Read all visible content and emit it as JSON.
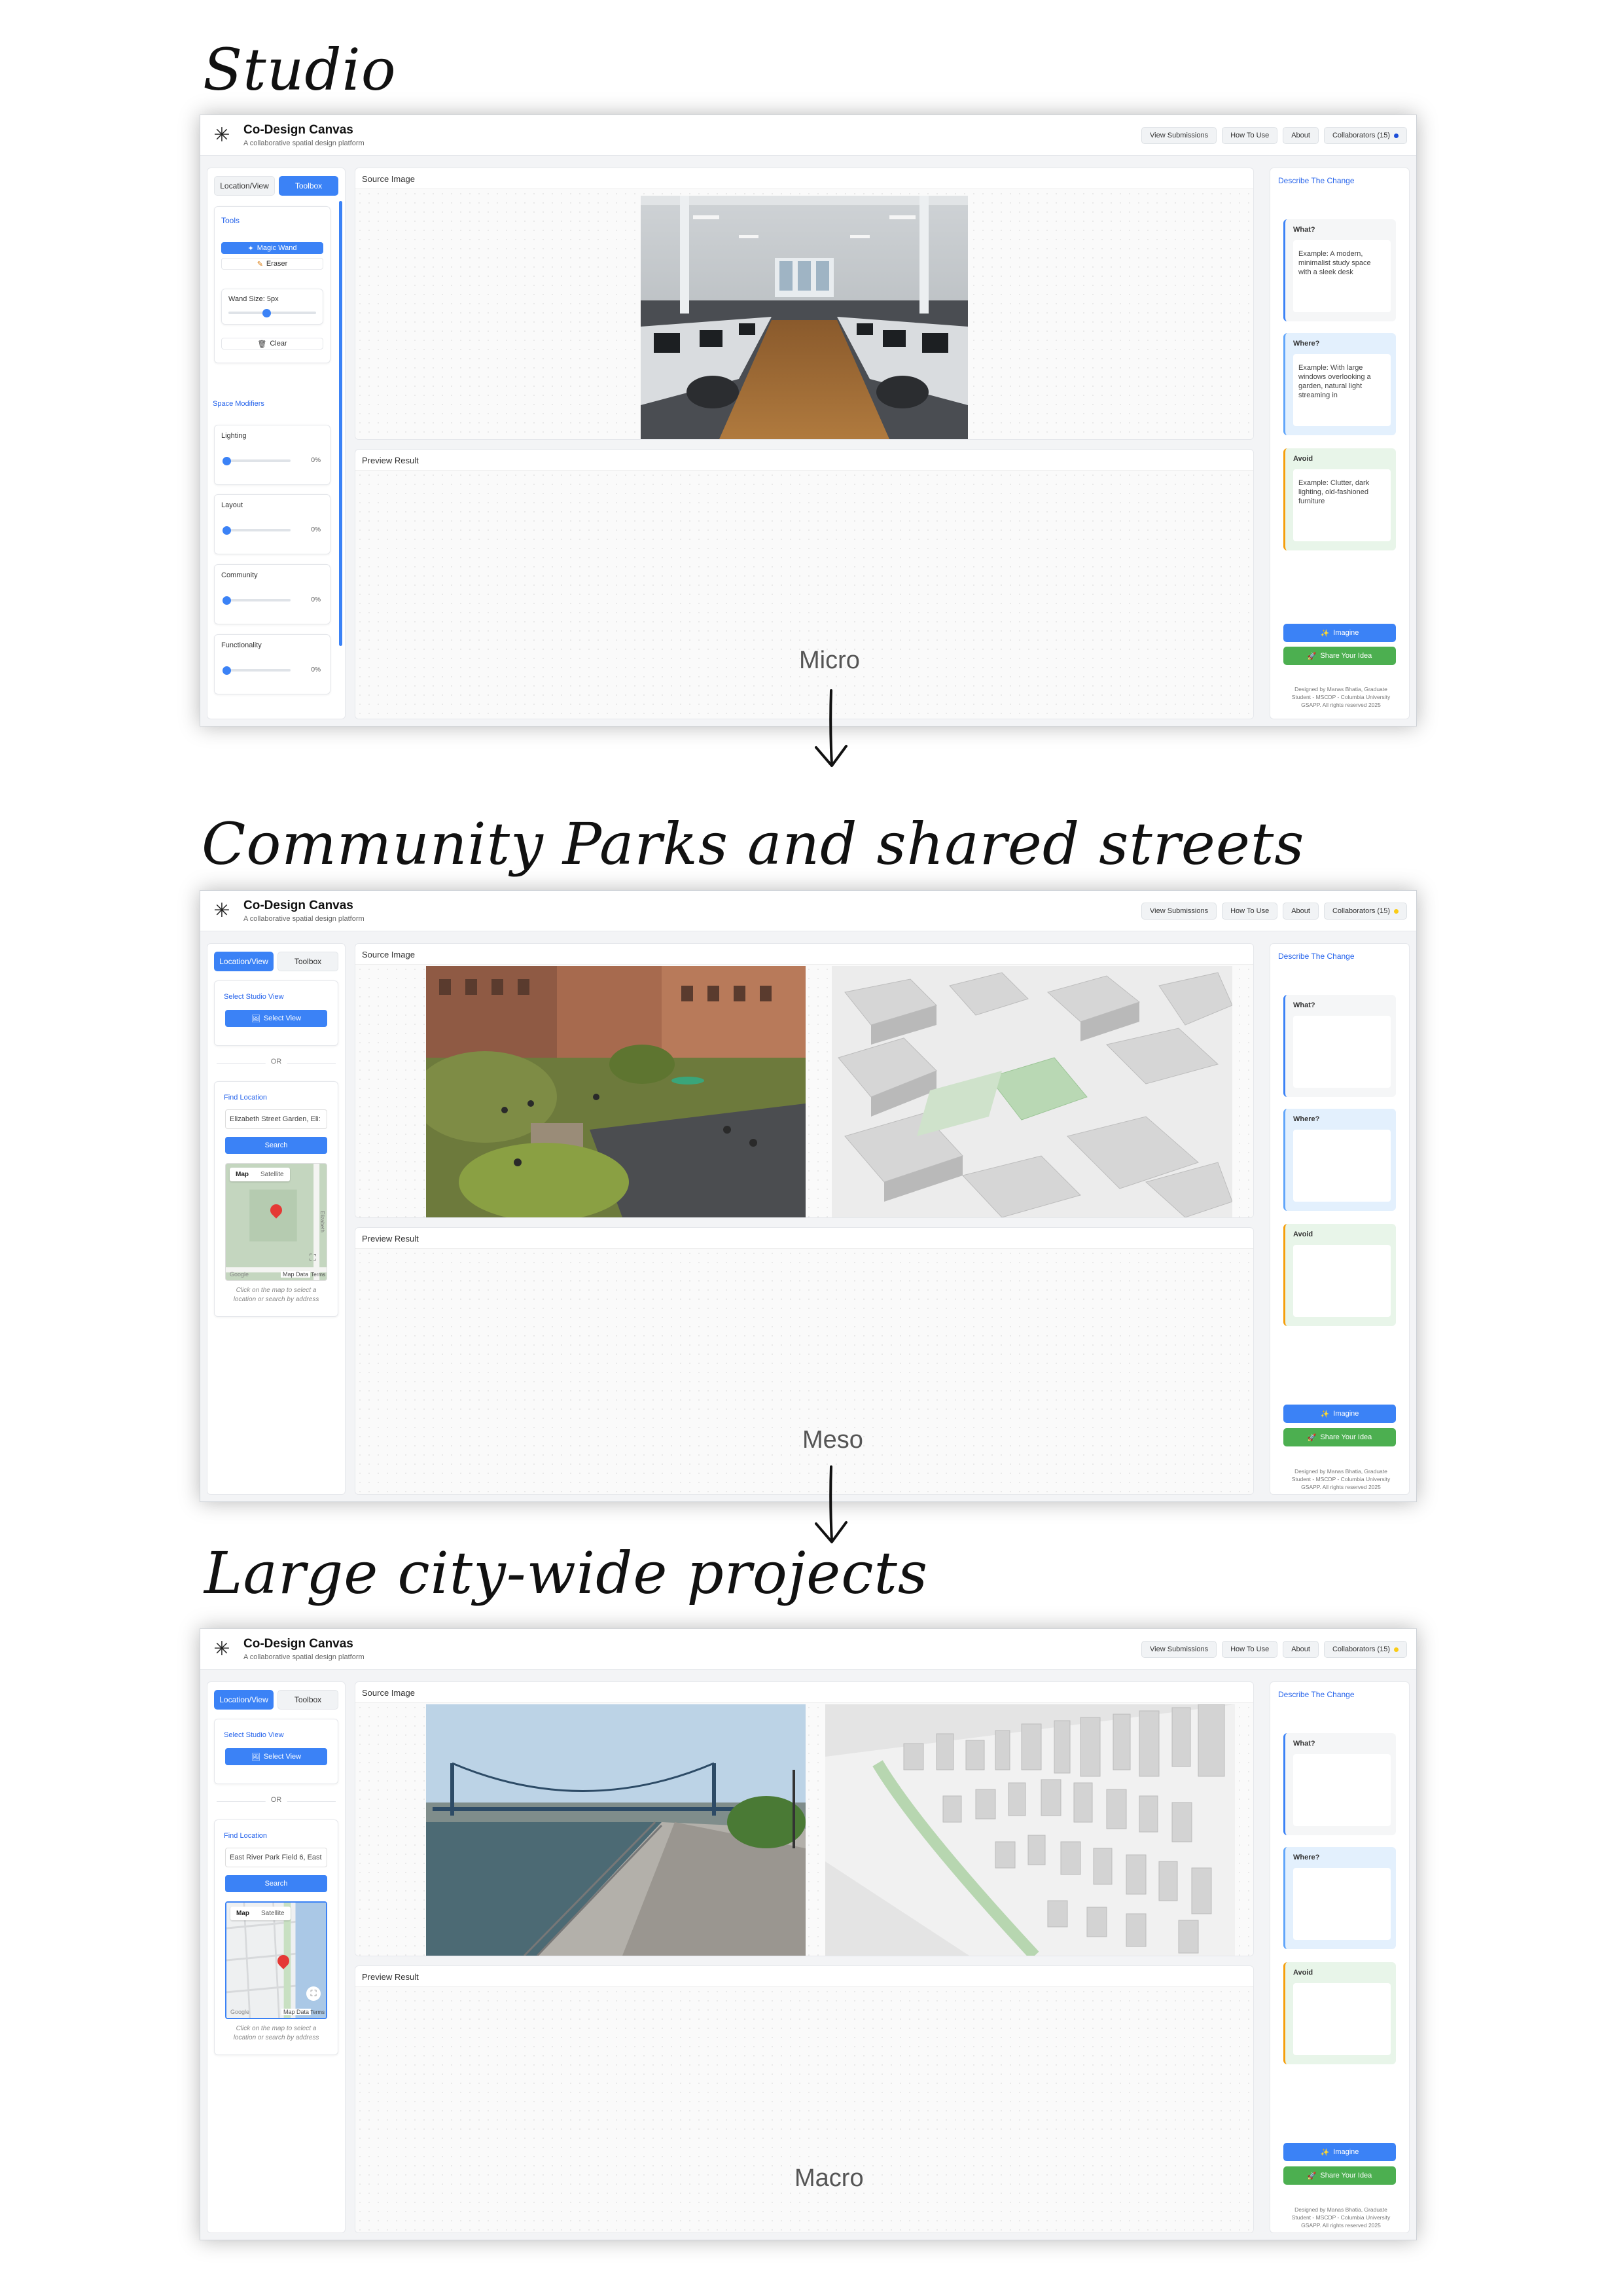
{
  "headings": {
    "studio": "Studio",
    "community": "Community Parks and shared streets",
    "large": "Large city-wide projects"
  },
  "scale_labels": {
    "micro": "Micro",
    "meso": "Meso",
    "macro": "Macro"
  },
  "app": {
    "title": "Co-Design Canvas",
    "subtitle": "A collaborative spatial design platform",
    "nav": {
      "view_submissions": "View Submissions",
      "how_to_use": "How To Use",
      "about": "About",
      "collaborators": "Collaborators (15)"
    },
    "status_colors": {
      "studio": "#1d4ed8",
      "meso": "#facc15",
      "macro": "#facc15"
    }
  },
  "tabs": {
    "location_view": "Location/View",
    "toolbox": "Toolbox"
  },
  "tools": {
    "section": "Tools",
    "magic_wand": "Magic Wand",
    "eraser": "Eraser",
    "wand_size": "Wand Size: 5px",
    "clear": "Clear"
  },
  "modifiers": {
    "section": "Space Modifiers",
    "items": [
      {
        "label": "Lighting",
        "value": "0%"
      },
      {
        "label": "Layout",
        "value": "0%"
      },
      {
        "label": "Community",
        "value": "0%"
      },
      {
        "label": "Functionality",
        "value": "0%"
      }
    ]
  },
  "location": {
    "select_studio_view": "Select Studio View",
    "select_view": "Select View",
    "or": "OR",
    "find_location": "Find Location",
    "search": "Search",
    "map_tab": "Map",
    "satellite_tab": "Satellite",
    "map_data": "Map Data",
    "terms": "Terms",
    "google": "Google",
    "map_hint": "Click on the map to select a location or search by address",
    "meso_query": "Elizabeth Street Garden, Eli:",
    "macro_query": "East River Park Field 6, East",
    "road_name": "Elizabeth"
  },
  "panels": {
    "source_image": "Source Image",
    "preview_result": "Preview Result"
  },
  "describe": {
    "title": "Describe The Change",
    "what": "What?",
    "where": "Where?",
    "avoid": "Avoid",
    "what_placeholder": "Example: A modern, minimalist study space with a sleek desk",
    "where_placeholder": "Example: With large windows overlooking a garden, natural light streaming in",
    "avoid_placeholder": "Example: Clutter, dark lighting, old-fashioned furniture",
    "imagine": "Imagine",
    "share": "Share Your Idea",
    "footer": "Designed by Manas Bhatia, Graduate Student - MSCDP - Columbia University GSAPP. All rights reserved 2025"
  },
  "colors": {
    "accent_blue": "#3b82f6",
    "share_green": "#4caf50",
    "where_bg": "#e3f0fd",
    "avoid_bg": "#e8f5e9",
    "avoid_border": "#f59e0b"
  }
}
